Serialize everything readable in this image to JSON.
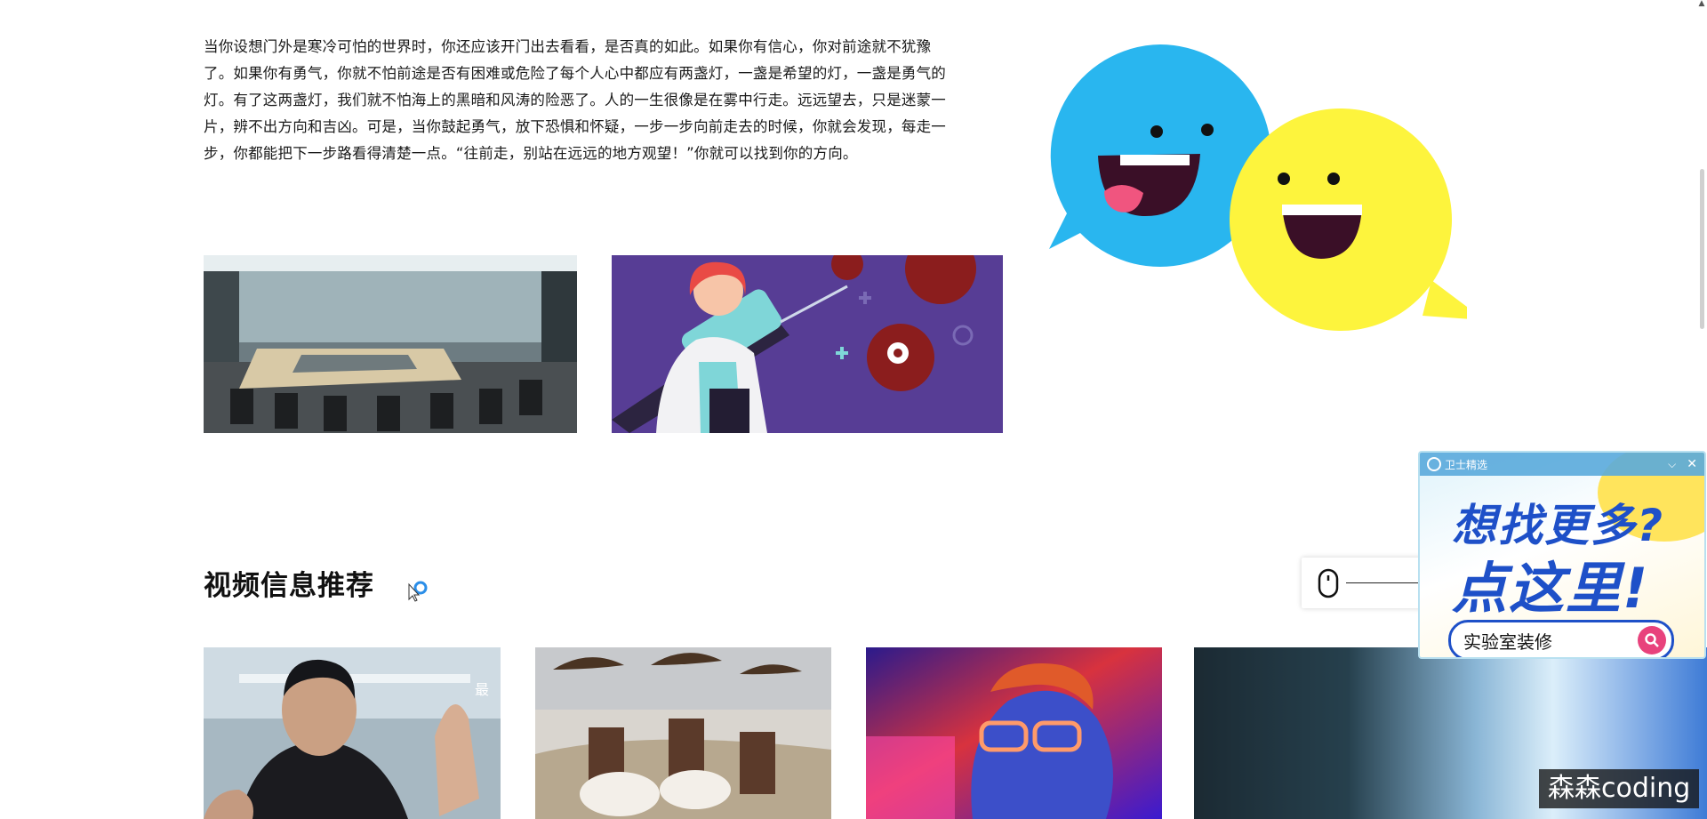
{
  "article": {
    "paragraph": "当你设想门外是寒冷可怕的世界时，你还应该开门出去看看，是否真的如此。如果你有信心，你对前途就不犹豫了。如果你有勇气，你就不怕前途是否有困难或危险了每个人心中都应有两盏灯，一盏是希望的灯，一盏是勇气的灯。有了这两盏灯，我们就不怕海上的黑暗和风涛的险恶了。人的一生很像是在雾中行走。远远望去，只是迷蒙一片，辨不出方向和吉凶。可是，当你鼓起勇气，放下恐惧和怀疑，一步一步向前走去的时候，你就会发现，每走一步，你都能把下一步路看得清楚一点。“往前走，别站在远远的地方观望！”你就可以找到你的方向。"
  },
  "section": {
    "title": "视频信息推荐"
  },
  "video_cards": [
    {
      "badge": "最"
    },
    {
      "badge": ""
    },
    {
      "badge": ""
    },
    {
      "badge": ""
    }
  ],
  "ad": {
    "brand": "卫士精选",
    "line1": "想找更多?",
    "line2": "点这里!",
    "search_text": "实验室装修"
  },
  "watermark": "森森coding",
  "icons": [
    "chat-bubbles-illustration",
    "mouse-icon",
    "loading-spinner-icon",
    "ad-logo-icon",
    "collapse-icon",
    "close-icon",
    "search-icon",
    "scroll-up-arrow-icon"
  ],
  "colors": {
    "bubble_blue": "#29b6ef",
    "bubble_yellow": "#fdf43d",
    "ad_blue": "#1e50c8",
    "ad_pink": "#e8427c"
  }
}
